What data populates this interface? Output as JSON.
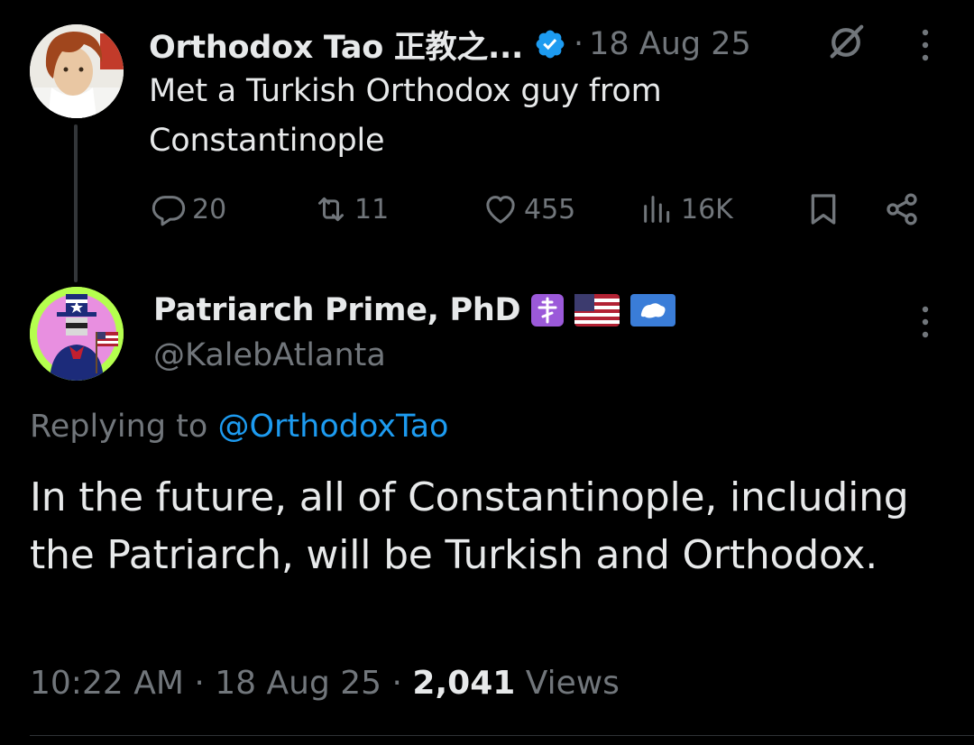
{
  "parent_tweet": {
    "author_name": "Orthodox Tao 正教之...",
    "separator": "·",
    "date": "18 Aug 25",
    "text": "Met a Turkish Orthodox guy from Constantinople",
    "actions": {
      "replies": "20",
      "retweets": "11",
      "likes": "455",
      "views": "16K"
    }
  },
  "reply_tweet": {
    "author_name": "Patriarch Prime, PhD",
    "name_emojis": [
      "orthodox-cross-emoji",
      "us-flag-emoji",
      "antarctica-flag-emoji"
    ],
    "handle": "@KalebAtlanta",
    "replying_prefix": "Replying to",
    "replying_mention": "@OrthodoxTao",
    "text": "In the future, all of Constantinople, including the Patriarch, will be Turkish and Orthodox.",
    "time": "10:22 AM",
    "date": "18 Aug 25",
    "separator": "·",
    "views_count": "2,041",
    "views_label": "Views"
  },
  "colors": {
    "background": "#000000",
    "primary_text": "#e7e9ea",
    "secondary_text": "#71767b",
    "accent": "#1d9bf0"
  }
}
